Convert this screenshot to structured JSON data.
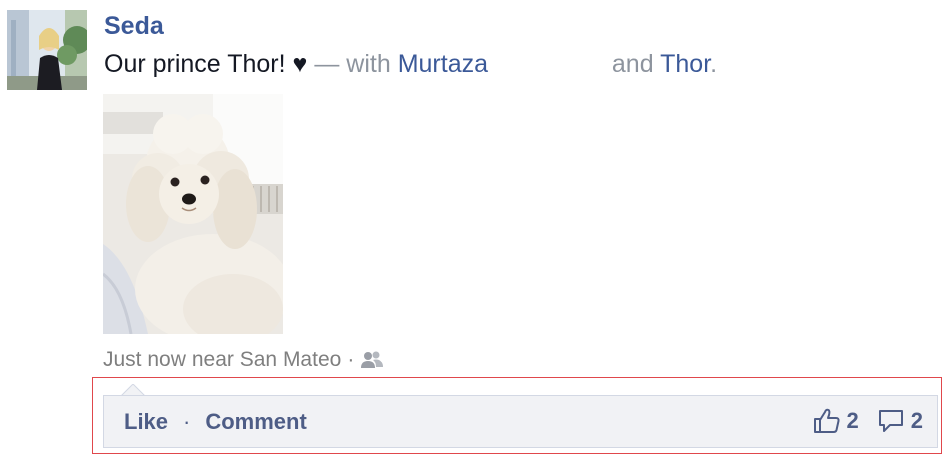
{
  "post": {
    "author": "Seda",
    "status_text": "Our prince Thor!",
    "heart_glyph": "♥",
    "dash": "—",
    "with_label": "with",
    "tagged_1": "Murtaza",
    "and_label": "and",
    "tagged_2": "Thor",
    "period": ".",
    "photo_icon": "dog-photo",
    "timestamp": "Just now",
    "location": "near San Mateo",
    "meta_dot": "·",
    "audience_icon": "friends-icon"
  },
  "ufi": {
    "like_label": "Like",
    "separator": "·",
    "comment_label": "Comment",
    "like_count": "2",
    "comment_count": "2",
    "like_icon": "thumbs-up-icon",
    "comment_icon": "comment-icon"
  },
  "colors": {
    "link": "#3b5998",
    "muted": "#8d949e",
    "ufi_bg": "#f1f2f5",
    "highlight": "#e0474c"
  }
}
